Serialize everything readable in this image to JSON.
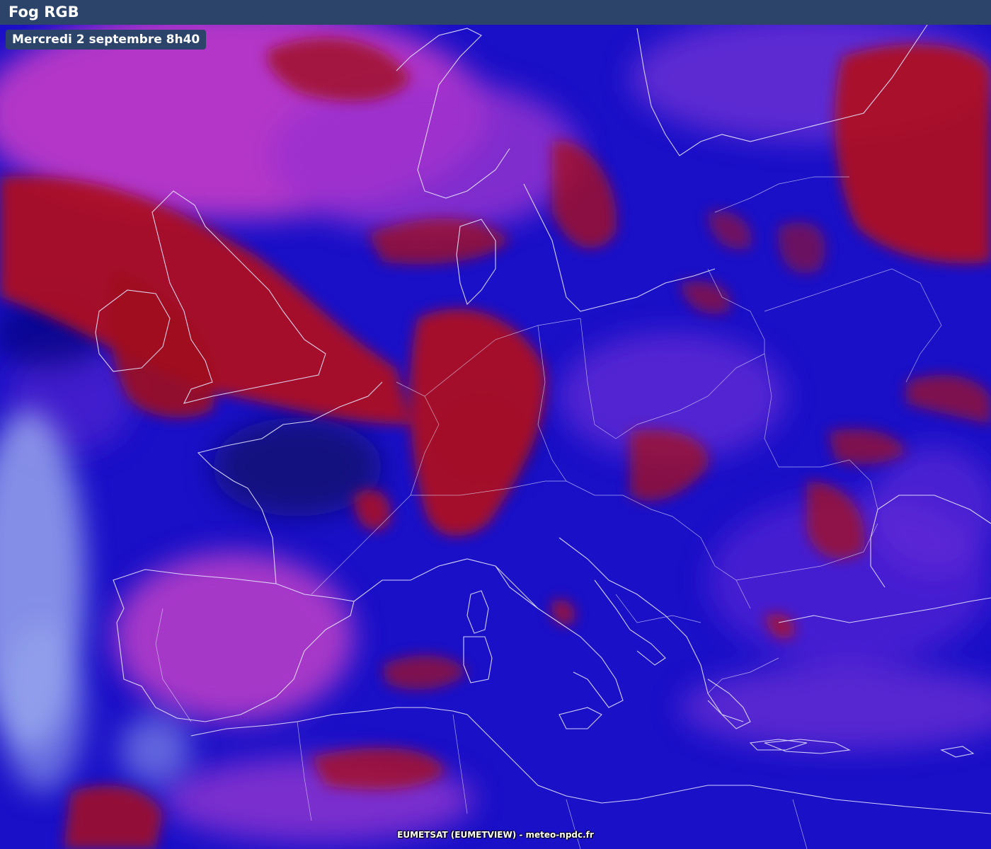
{
  "header": {
    "title": "Fog RGB"
  },
  "map": {
    "date_label": "Mercredi 2 septembre 8h40",
    "credit": "EUMETSAT (EUMETVIEW) - meteo-npdc.fr",
    "colors": {
      "background_blue": "#1a10c8",
      "low_cloud_red": "#b0101e",
      "high_cloud_magenta": "#c02cc8",
      "ice_cloud_light": "#b8c4f0",
      "coastline": "#e8e8ff"
    }
  }
}
